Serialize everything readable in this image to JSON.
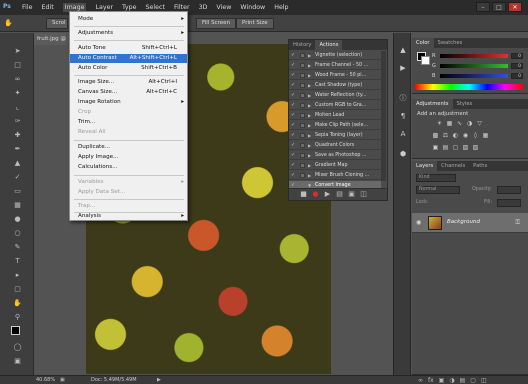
{
  "menubar": {
    "logo": "Ps",
    "items": [
      "File",
      "Edit",
      "Image",
      "Layer",
      "Type",
      "Select",
      "Filter",
      "3D",
      "View",
      "Window",
      "Help"
    ],
    "window_controls": [
      "–",
      "□",
      "✕"
    ]
  },
  "optionsbar": {
    "scroll_label": "Scrol",
    "fill_screen": "Fill Screen",
    "print_size": "Print Size"
  },
  "document": {
    "tab_title": "fruit.jpg @"
  },
  "image_menu": {
    "items": [
      {
        "label": "Mode",
        "submenu": true
      },
      {
        "label": "Adjustments",
        "submenu": true
      },
      {
        "label": "Auto Tone",
        "shortcut": "Shift+Ctrl+L"
      },
      {
        "label": "Auto Contrast",
        "shortcut": "Alt+Shift+Ctrl+L",
        "highlighted": true
      },
      {
        "label": "Auto Color",
        "shortcut": "Shift+Ctrl+B"
      },
      {
        "label": "Image Size...",
        "shortcut": "Alt+Ctrl+I"
      },
      {
        "label": "Canvas Size...",
        "shortcut": "Alt+Ctrl+C"
      },
      {
        "label": "Image Rotation",
        "submenu": true
      },
      {
        "label": "Crop",
        "disabled": true
      },
      {
        "label": "Trim..."
      },
      {
        "label": "Reveal All",
        "disabled": true
      },
      {
        "label": "Duplicate..."
      },
      {
        "label": "Apply Image..."
      },
      {
        "label": "Calculations..."
      },
      {
        "label": "Variables",
        "submenu": true,
        "disabled": true
      },
      {
        "label": "Apply Data Set...",
        "disabled": true
      },
      {
        "label": "Trap...",
        "disabled": true
      },
      {
        "label": "Analysis",
        "submenu": true
      }
    ]
  },
  "actions_panel": {
    "tabs": [
      "History",
      "Actions"
    ],
    "rows": [
      "Vignette (selection)",
      "Frame Channel - 50 ...",
      "Wood Frame - 50 pi...",
      "Cast Shadow (type)",
      "Water Reflection (ty...",
      "Custom RGB to Gra...",
      "Molten Lead",
      "Make Clip Path (sele...",
      "Sepia Toning (layer)",
      "Quadrant Colors",
      "Save as Photoshop ...",
      "Gradient Map",
      "Mixer Brush Cloning ...",
      "Convert Image"
    ]
  },
  "color_panel": {
    "tabs": [
      "Color",
      "Swatches"
    ],
    "channels": [
      {
        "label": "R",
        "value": "0",
        "color": "#e03030"
      },
      {
        "label": "G",
        "value": "0",
        "color": "#30c030"
      },
      {
        "label": "B",
        "value": "0",
        "color": "#3050e0"
      }
    ]
  },
  "adjustments_panel": {
    "tabs": [
      "Adjustments",
      "Styles"
    ],
    "title": "Add an adjustment"
  },
  "layers_panel": {
    "tabs": [
      "Layers",
      "Channels",
      "Paths"
    ],
    "kind_filter": "Kind",
    "blend_mode": "Normal",
    "opacity_label": "Opacity:",
    "lock_label": "Lock:",
    "fill_label": "Fill:",
    "layer_name": "Background"
  },
  "statusbar": {
    "zoom": "40.68%",
    "doc_size": "Doc: 5.49M/5.49M"
  }
}
